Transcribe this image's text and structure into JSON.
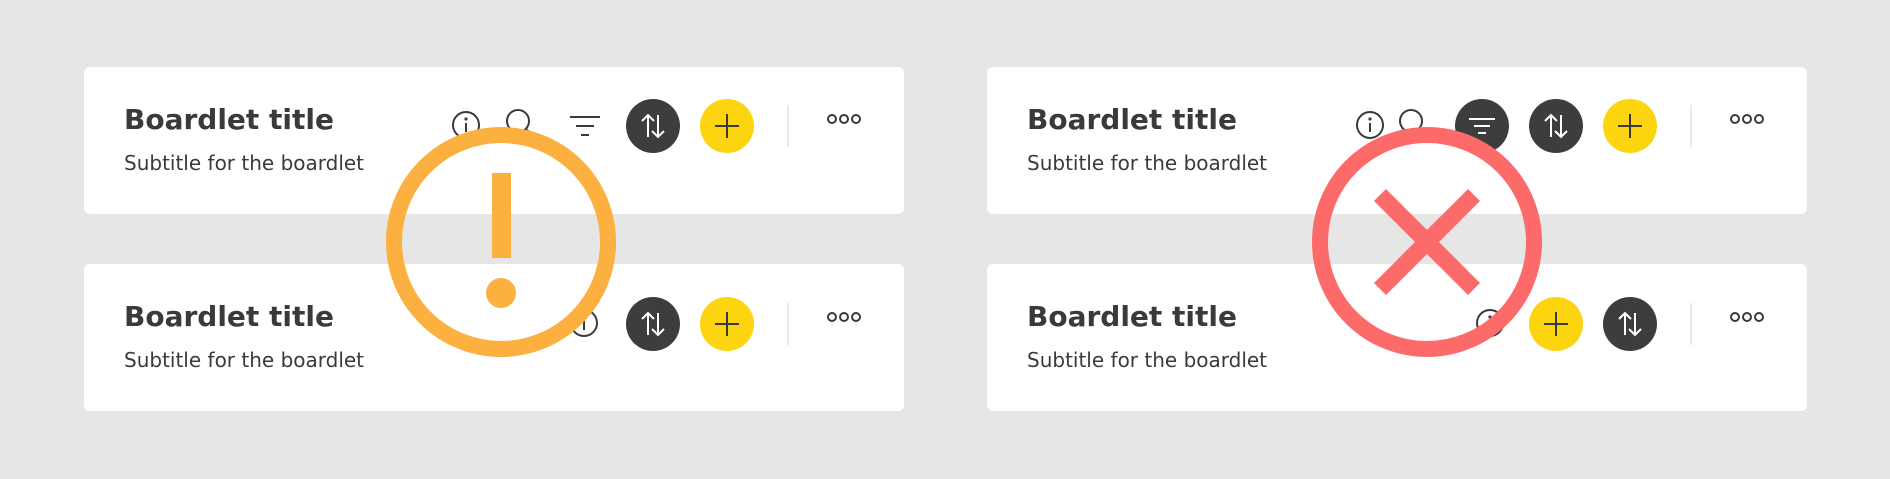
{
  "colors": {
    "background": "#e6e6e6",
    "card": "#ffffff",
    "text": "#3a3a3a",
    "dark_button": "#3d3d3d",
    "accent_yellow": "#fcd410",
    "warning": "#fbb040",
    "error": "#fd6a6a"
  },
  "cards": [
    {
      "title": "Boardlet title",
      "subtitle": "Subtitle for the boardlet"
    },
    {
      "title": "Boardlet title",
      "subtitle": "Subtitle for the boardlet"
    },
    {
      "title": "Boardlet title",
      "subtitle": "Subtitle for the boardlet"
    },
    {
      "title": "Boardlet title",
      "subtitle": "Subtitle for the boardlet"
    }
  ],
  "icons": {
    "info": "info-icon",
    "search": "search-icon",
    "filter": "filter-icon",
    "sort": "sort-icon",
    "add": "add-icon",
    "more": "more-icon",
    "warning": "warning-icon",
    "error": "error-icon"
  }
}
